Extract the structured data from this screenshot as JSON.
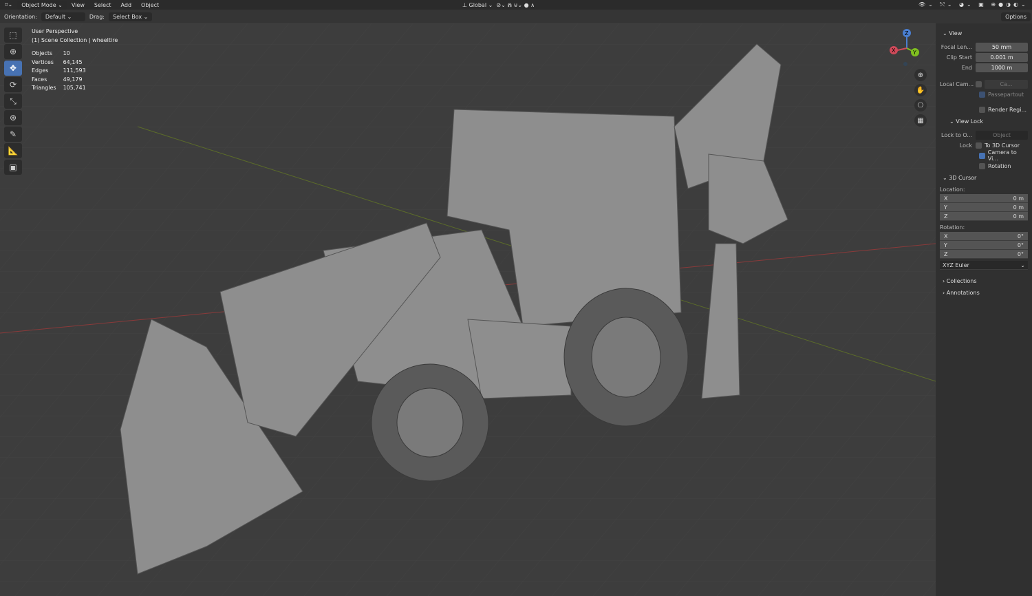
{
  "header": {
    "mode": "Object Mode",
    "menus": [
      "View",
      "Select",
      "Add",
      "Object"
    ],
    "orientation_label": "Orientation:",
    "orientation": "Default",
    "drag_label": "Drag:",
    "drag": "Select Box",
    "transform": "Global",
    "options": "Options"
  },
  "overlay": {
    "view": "User Perspective",
    "collection": "(1) Scene Collection | wheeltire",
    "stats": [
      {
        "k": "Objects",
        "v": "10"
      },
      {
        "k": "Vertices",
        "v": "64,145"
      },
      {
        "k": "Edges",
        "v": "111,593"
      },
      {
        "k": "Faces",
        "v": "49,179"
      },
      {
        "k": "Triangles",
        "v": "105,741"
      }
    ]
  },
  "gizmo": {
    "x": "X",
    "y": "Y",
    "z": "Z"
  },
  "panel": {
    "view": "View",
    "focal_label": "Focal Len...",
    "focal": "50 mm",
    "clip_start_label": "Clip Start",
    "clip_start": "0.001 m",
    "end_label": "End",
    "end": "1000 m",
    "local_cam": "Local Cam...",
    "local_cam_value": "Ca...",
    "passepartout": "Passepartout",
    "render_region": "Render Regi...",
    "view_lock": "View Lock",
    "lock_to": "Lock to O...",
    "lock_obj": "Object",
    "lock": "Lock",
    "to_cursor": "To 3D Cursor",
    "camera_to_view": "Camera to Vi...",
    "rotation_cb": "Rotation",
    "cursor": "3D Cursor",
    "location": "Location:",
    "loc": [
      {
        "a": "X",
        "v": "0 m"
      },
      {
        "a": "Y",
        "v": "0 m"
      },
      {
        "a": "Z",
        "v": "0 m"
      }
    ],
    "rotation": "Rotation:",
    "rot": [
      {
        "a": "X",
        "v": "0°"
      },
      {
        "a": "Y",
        "v": "0°"
      },
      {
        "a": "Z",
        "v": "0°"
      }
    ],
    "euler": "XYZ Euler",
    "collections": "Collections",
    "annotations": "Annotations"
  }
}
